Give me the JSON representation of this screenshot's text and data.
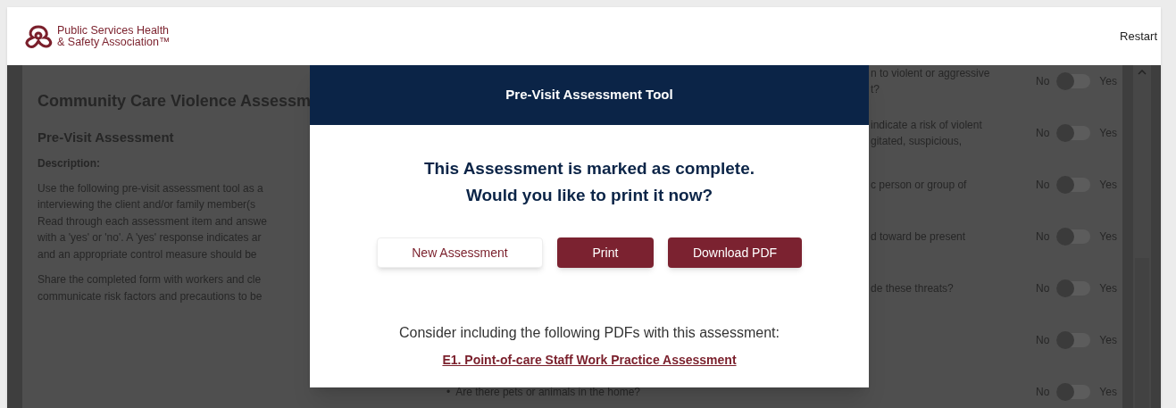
{
  "header": {
    "logo_lines": [
      "Public Services Health",
      "& Safety Association™"
    ],
    "restart": "Restart"
  },
  "left_panel": {
    "title": "Community Care Violence Assessm",
    "subtitle": "Pre-Visit Assessment",
    "label": "Description:",
    "paragraphs": [
      [
        "Use the following pre-visit assessment tool as a",
        "interviewing the client and/or family member(s",
        "Read through each assessment item and answe",
        "with a 'yes' or 'no'. A 'yes' response indicates ar",
        "and an appropriate control measure should be"
      ],
      [
        "Share the completed form with workers and cle",
        "communicate risk factors and precautions to be"
      ]
    ]
  },
  "questions": [
    {
      "kind": "partial",
      "lines": [
        "n to violent or aggressive",
        "t?"
      ],
      "no": "No",
      "yes": "Yes",
      "on": false
    },
    {
      "kind": "partial",
      "lines": [
        "indicate a risk of violent",
        "gitated, suspicious,"
      ],
      "no": "No",
      "yes": "Yes",
      "on": false
    },
    {
      "kind": "partial",
      "lines": [
        "c person or group of"
      ],
      "no": "No",
      "yes": "Yes",
      "on": false
    },
    {
      "kind": "partial",
      "lines": [
        "d toward be present"
      ],
      "no": "No",
      "yes": "Yes",
      "on": false
    },
    {
      "kind": "partial",
      "lines": [
        "de these threats?"
      ],
      "no": "No",
      "yes": "Yes",
      "on": false
    },
    {
      "kind": "partial",
      "no": "No",
      "yes": "Yes",
      "on": false
    },
    {
      "kind": "bullet",
      "bullet": "•",
      "lines": [
        "Are there pets or animals in the home?"
      ],
      "no": "No",
      "yes": "Yes",
      "on": false
    }
  ],
  "modal": {
    "title": "Pre-Visit Assessment Tool",
    "message": [
      "This Assessment is marked as complete.",
      "Would you like to print it now?"
    ],
    "buttons": [
      {
        "label": "New Assessment",
        "kind": "secondary"
      },
      {
        "label": "Print",
        "kind": "primary"
      },
      {
        "label": "Download PDF",
        "kind": "primary"
      }
    ],
    "note": "Consider including the following PDFs with this assessment:",
    "link": "E1. Point-of-care Staff Work Practice Assessment"
  }
}
